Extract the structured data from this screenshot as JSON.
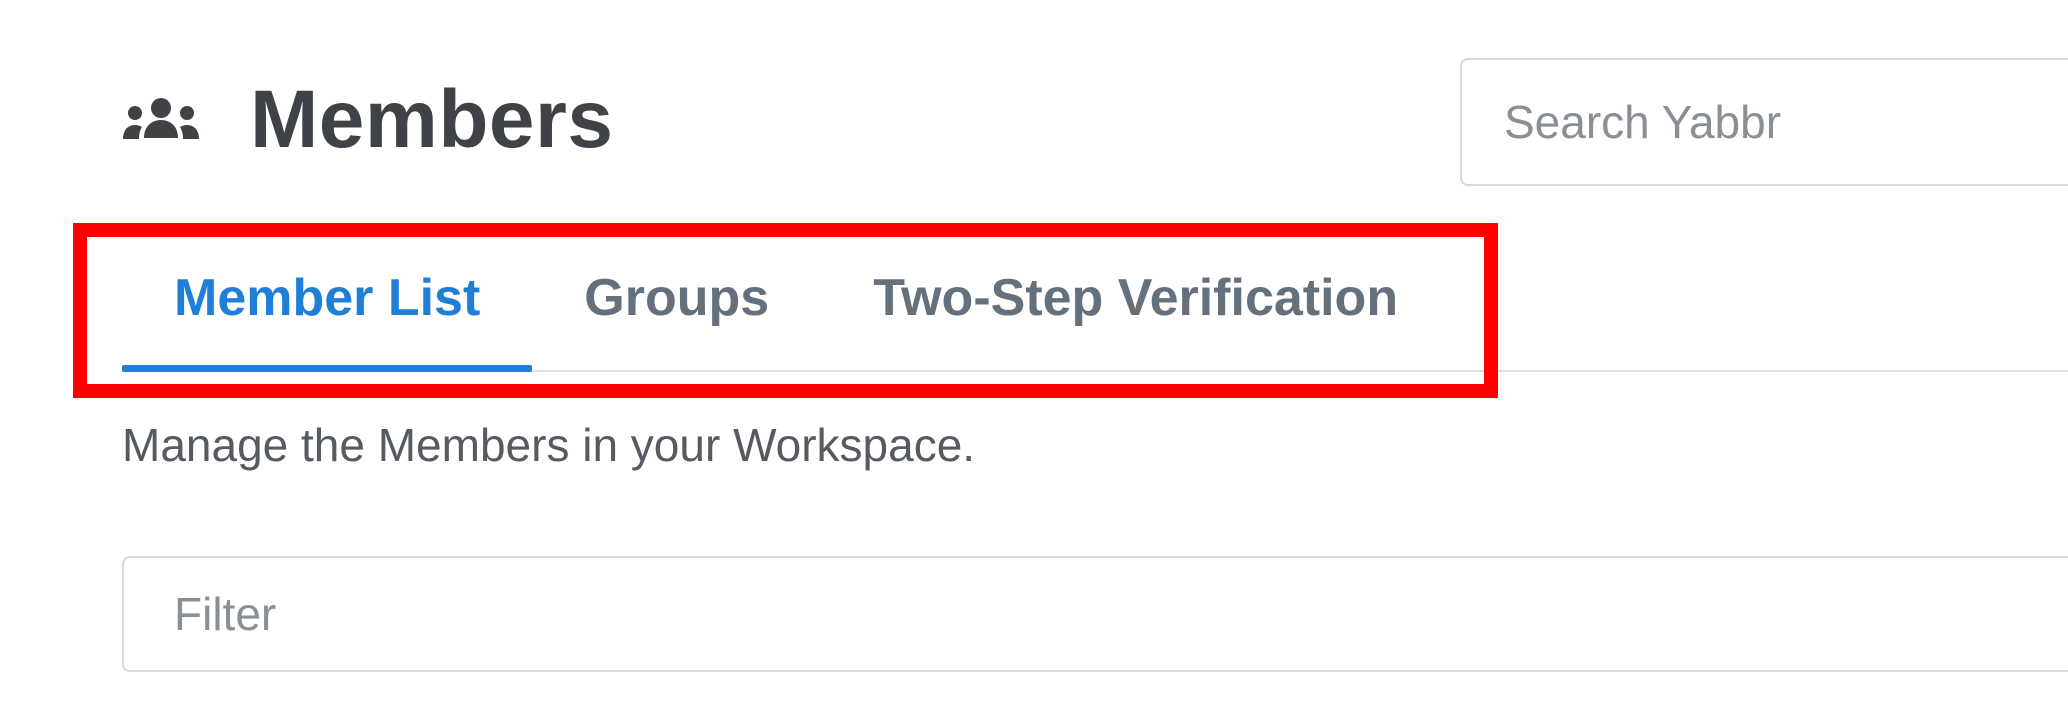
{
  "header": {
    "title": "Members",
    "icon": "users-icon"
  },
  "search": {
    "placeholder": "Search Yabbr",
    "value": ""
  },
  "tabs": [
    {
      "label": "Member List",
      "active": true
    },
    {
      "label": "Groups",
      "active": false
    },
    {
      "label": "Two-Step Verification",
      "active": false
    }
  ],
  "description": "Manage the Members in your Workspace.",
  "filter": {
    "placeholder": "Filter",
    "value": ""
  },
  "colors": {
    "accent": "#1f7fd8",
    "highlight": "#ff0000",
    "title_text": "#3f4247",
    "inactive_tab": "#64707c"
  }
}
